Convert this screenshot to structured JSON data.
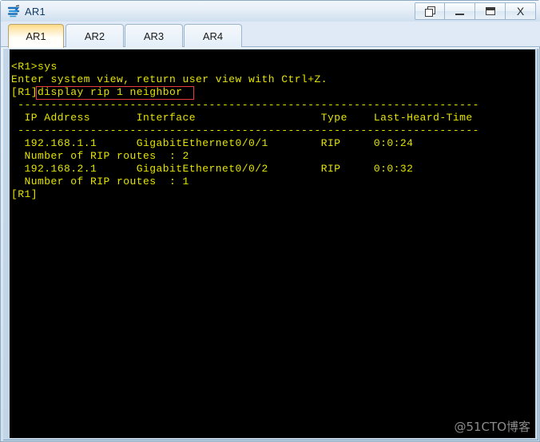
{
  "window": {
    "title": "AR1",
    "icon": "router-icon",
    "buttons": [
      {
        "name": "restore-button",
        "label": "❐",
        "glyph": "restore-icon"
      },
      {
        "name": "minimize-button",
        "label": "_",
        "glyph": "minimize-icon"
      },
      {
        "name": "maximize-button",
        "label": "☐",
        "glyph": "maximize-icon"
      },
      {
        "name": "close-button",
        "label": "X",
        "glyph": "close-icon"
      }
    ]
  },
  "tabs": {
    "active_index": 0,
    "items": [
      {
        "label": "AR1"
      },
      {
        "label": "AR2"
      },
      {
        "label": "AR3"
      },
      {
        "label": "AR4"
      }
    ]
  },
  "terminal": {
    "foreground": "#e3e300",
    "background": "#000000",
    "highlight_color": "#e83b3b",
    "lines": [
      "<R1>sys",
      "Enter system view, return user view with Ctrl+Z.",
      "[R1]display rip 1 neighbor",
      " ----------------------------------------------------------------------",
      "  IP Address       Interface                   Type    Last-Heard-Time",
      " ----------------------------------------------------------------------",
      "  192.168.1.1      GigabitEthernet0/0/1        RIP     0:0:24",
      "  Number of RIP routes  : 2",
      "  192.168.2.1      GigabitEthernet0/0/2        RIP     0:0:32",
      "  Number of RIP routes  : 1",
      "[R1]"
    ],
    "highlighted_command": "display rip 1 neighbor"
  },
  "watermark": {
    "text": "@51CTO博客"
  }
}
